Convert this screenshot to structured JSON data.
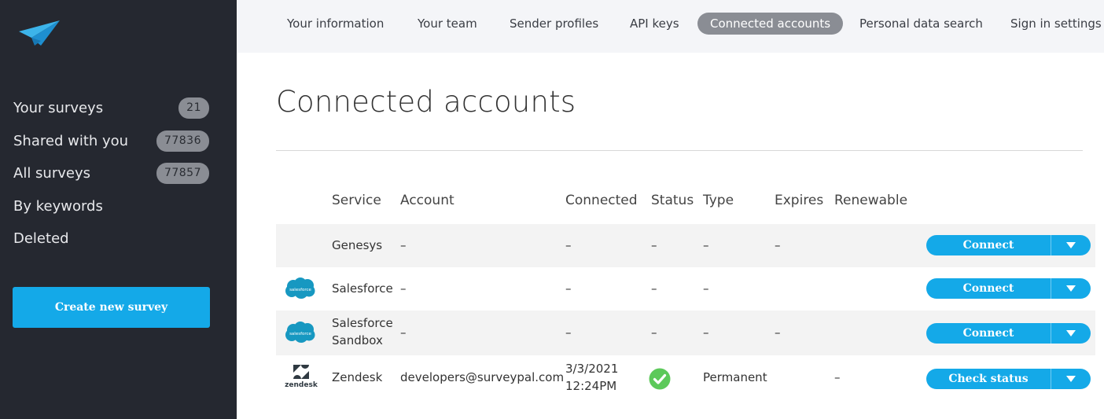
{
  "sidebar": {
    "items": [
      {
        "label": "Your surveys",
        "count": "21"
      },
      {
        "label": "Shared with you",
        "count": "77836"
      },
      {
        "label": "All surveys",
        "count": "77857"
      },
      {
        "label": "By keywords"
      },
      {
        "label": "Deleted"
      }
    ],
    "create_button": "Create new survey"
  },
  "topnav": {
    "tabs": [
      {
        "label": "Your information"
      },
      {
        "label": "Your team"
      },
      {
        "label": "Sender profiles"
      },
      {
        "label": "API keys"
      },
      {
        "label": "Connected accounts",
        "active": true
      },
      {
        "label": "Personal data search"
      },
      {
        "label": "Sign in settings"
      }
    ]
  },
  "page": {
    "title": "Connected accounts"
  },
  "table": {
    "headers": {
      "service": "Service",
      "account": "Account",
      "connected": "Connected",
      "status": "Status",
      "type": "Type",
      "expires": "Expires",
      "renewable": "Renewable"
    },
    "rows": [
      {
        "service": "Genesys",
        "account": "–",
        "connected": "–",
        "status": "–",
        "type": "–",
        "expires": "–",
        "renewable": "",
        "action": "Connect",
        "icon": "none"
      },
      {
        "service": "Salesforce",
        "account": "–",
        "connected": "–",
        "status": "–",
        "type": "–",
        "expires": "",
        "renewable": "",
        "action": "Connect",
        "icon": "salesforce-icon"
      },
      {
        "service_line1": "Salesforce",
        "service_line2": "Sandbox",
        "account": "–",
        "connected": "–",
        "status": "–",
        "type": "–",
        "expires": "–",
        "renewable": "",
        "action": "Connect",
        "icon": "salesforce-icon"
      },
      {
        "service": "Zendesk",
        "account": "developers@surveypal.com",
        "connected_date": "3/3/2021",
        "connected_time": "12:24PM",
        "status": "ok",
        "type": "Permanent",
        "expires": "",
        "renewable": "–",
        "action": "Check status",
        "icon": "zendesk-icon",
        "icon_text": "zendesk"
      }
    ]
  },
  "colors": {
    "sidebar_bg": "#252830",
    "accent": "#14a9e8",
    "badge": "#8a8d94",
    "success": "#5cc95a"
  }
}
